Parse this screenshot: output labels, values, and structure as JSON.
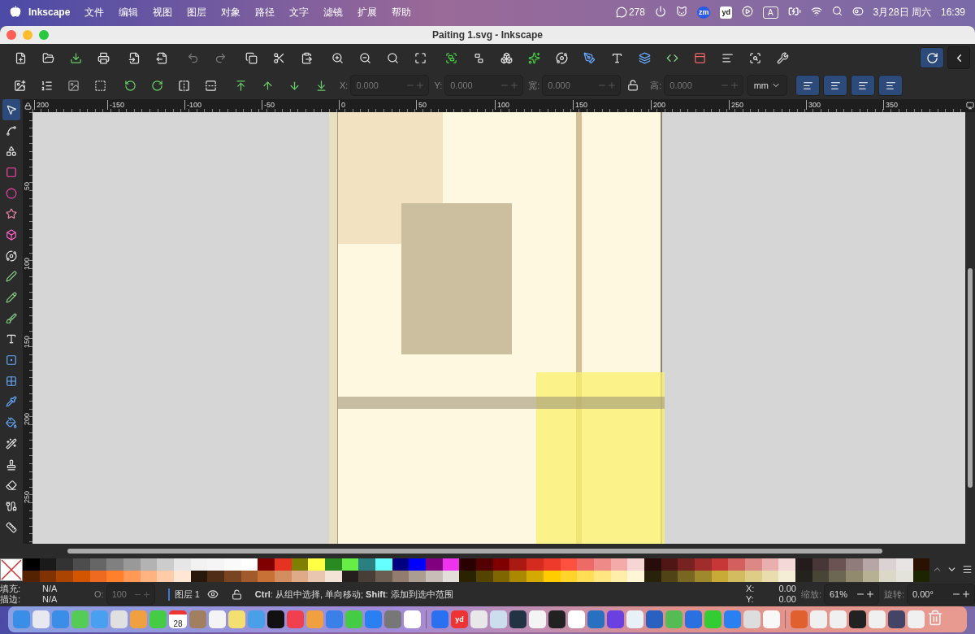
{
  "menubar": {
    "app": "Inkscape",
    "menus": [
      "文件",
      "编辑",
      "视图",
      "图层",
      "对象",
      "路径",
      "文字",
      "滤镜",
      "扩展",
      "帮助"
    ],
    "chat_count": "278",
    "zoom_label": "zm",
    "dict_label": "yd",
    "input_source": "A",
    "date": "3月28日 周六",
    "time": "16:39"
  },
  "window": {
    "title": "Paiting 1.svg - Inkscape"
  },
  "snap": {
    "on": true
  },
  "tool_controls": {
    "fields": [
      {
        "label": "X:",
        "value": "0.000"
      },
      {
        "label": "Y:",
        "value": "0.000"
      },
      {
        "label": "宽:",
        "value": "0.000"
      },
      {
        "label": "高:",
        "value": "0.000"
      }
    ],
    "unit": "mm",
    "transform_toggles": [
      {
        "on": true
      },
      {
        "on": true
      },
      {
        "on": true
      },
      {
        "on": true
      }
    ]
  },
  "toolbox": {
    "tools": [
      {
        "selected": true
      },
      {
        "selected": false
      },
      {
        "selected": false
      },
      {
        "selected": false
      },
      {
        "selected": false
      },
      {
        "selected": false
      },
      {
        "selected": false
      },
      {
        "selected": false
      },
      {
        "selected": false
      },
      {
        "selected": false
      },
      {
        "selected": false
      },
      {
        "selected": false
      },
      {
        "selected": false
      },
      {
        "selected": false
      },
      {
        "selected": false
      },
      {
        "selected": false
      },
      {
        "selected": false
      },
      {
        "selected": false
      },
      {
        "selected": false
      },
      {
        "selected": false
      },
      {
        "selected": false
      }
    ]
  },
  "rulers": {
    "horizontal": [
      "200",
      "-150",
      "-100",
      "-50",
      "0",
      "50",
      "100",
      "150",
      "200",
      "250",
      "300",
      "350"
    ],
    "vertical": [
      "50",
      "100",
      "150",
      "200",
      "250"
    ]
  },
  "palette": {
    "top": [
      {
        "color": "#000000"
      },
      {
        "color": "#1a1a1a"
      },
      {
        "color": "#333333"
      },
      {
        "color": "#4d4d4d"
      },
      {
        "color": "#666666"
      },
      {
        "color": "#808080"
      },
      {
        "color": "#999999"
      },
      {
        "color": "#b3b3b3"
      },
      {
        "color": "#cccccc"
      },
      {
        "color": "#e6e6e6"
      },
      {
        "color": "#f2f2f2"
      },
      {
        "color": "#f5f5f5"
      },
      {
        "color": "#fafafa"
      },
      {
        "color": "#ffffff"
      },
      {
        "color": "#800000"
      },
      {
        "color": "#e53222"
      },
      {
        "color": "#808000"
      },
      {
        "color": "#ffff44"
      },
      {
        "color": "#2a8a22"
      },
      {
        "color": "#66ee44"
      },
      {
        "color": "#2a8080"
      },
      {
        "color": "#66ffff"
      },
      {
        "color": "#000080"
      },
      {
        "color": "#0000ff"
      },
      {
        "color": "#800080"
      },
      {
        "color": "#ee33ee"
      },
      {
        "color": "#2b0000"
      },
      {
        "color": "#550000"
      },
      {
        "color": "#800000"
      },
      {
        "color": "#aa1a10"
      },
      {
        "color": "#d42a20"
      },
      {
        "color": "#ee3a2a"
      },
      {
        "color": "#ff5040"
      },
      {
        "color": "#ee6a66"
      },
      {
        "color": "#ee8a88"
      },
      {
        "color": "#f5aaaa"
      },
      {
        "color": "#f8d5d5"
      },
      {
        "color": "#280b0b"
      },
      {
        "color": "#501616"
      },
      {
        "color": "#782121"
      },
      {
        "color": "#a02c2c"
      },
      {
        "color": "#c83737"
      },
      {
        "color": "#d35f5f"
      },
      {
        "color": "#de8787"
      },
      {
        "color": "#e9afaf"
      },
      {
        "color": "#f4d7d7"
      },
      {
        "color": "#241c1c"
      },
      {
        "color": "#483737"
      },
      {
        "color": "#6c5353"
      },
      {
        "color": "#917c7c"
      },
      {
        "color": "#b7a6a6"
      },
      {
        "color": "#dbd3d3"
      },
      {
        "color": "#e8e4e4"
      },
      {
        "color": "#2b1100"
      }
    ],
    "bottom": [
      {
        "color": "#552200"
      },
      {
        "color": "#803300"
      },
      {
        "color": "#aa4400"
      },
      {
        "color": "#d45500"
      },
      {
        "color": "#ee6a20"
      },
      {
        "color": "#ff7f2a"
      },
      {
        "color": "#ff9955"
      },
      {
        "color": "#ffb380"
      },
      {
        "color": "#ffccaa"
      },
      {
        "color": "#ffe6d5"
      },
      {
        "color": "#28170b"
      },
      {
        "color": "#502d16"
      },
      {
        "color": "#784421"
      },
      {
        "color": "#a05a2c"
      },
      {
        "color": "#c87137"
      },
      {
        "color": "#d38d5f"
      },
      {
        "color": "#deaa87"
      },
      {
        "color": "#e9c6af"
      },
      {
        "color": "#f4e3d7"
      },
      {
        "color": "#241f1c"
      },
      {
        "color": "#483e37"
      },
      {
        "color": "#6c5d53"
      },
      {
        "color": "#917c6f"
      },
      {
        "color": "#ac9d93"
      },
      {
        "color": "#c8beb7"
      },
      {
        "color": "#e3dedb"
      },
      {
        "color": "#2b2200"
      },
      {
        "color": "#554400"
      },
      {
        "color": "#806600"
      },
      {
        "color": "#aa8800"
      },
      {
        "color": "#d4aa00"
      },
      {
        "color": "#ffcc00"
      },
      {
        "color": "#ffd42a"
      },
      {
        "color": "#ffdd55"
      },
      {
        "color": "#ffe680"
      },
      {
        "color": "#ffeeaa"
      },
      {
        "color": "#fff6d5"
      },
      {
        "color": "#28220b"
      },
      {
        "color": "#504416"
      },
      {
        "color": "#786721"
      },
      {
        "color": "#a0892c"
      },
      {
        "color": "#c8ab37"
      },
      {
        "color": "#d3bc5f"
      },
      {
        "color": "#decd87"
      },
      {
        "color": "#e9ddaf"
      },
      {
        "color": "#f4eed7"
      },
      {
        "color": "#24221c"
      },
      {
        "color": "#484537"
      },
      {
        "color": "#6c6753"
      },
      {
        "color": "#918a6f"
      },
      {
        "color": "#b7b193"
      },
      {
        "color": "#dbd8c8"
      },
      {
        "color": "#e3e2db"
      },
      {
        "color": "#1c2400"
      }
    ]
  },
  "status_bar": {
    "fill_label": "填充:",
    "fill_value": "N/A",
    "stroke_label": "描边:",
    "stroke_value": "N/A",
    "opacity_label": "O:",
    "opacity_value": "100",
    "layer": "图层 1",
    "message": "**Ctrl**: 从组中选择, 单向移动; **Shift**: 添加到选中范围",
    "x_label": "X:",
    "x_value": "0.00",
    "y_label": "Y:",
    "y_value": "0.00",
    "zoom_label": "缩放:",
    "zoom_value": "61%",
    "rotate_label": "旋转:",
    "rotate_value": "0.00°"
  },
  "dock": {
    "calendar_day": "28",
    "dict_label": "yd"
  }
}
